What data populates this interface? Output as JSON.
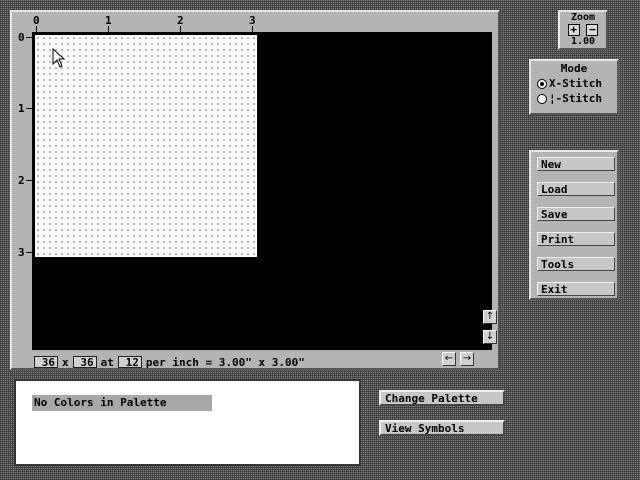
{
  "canvas": {
    "ruler_top": [
      "0",
      "1",
      "2",
      "3"
    ],
    "ruler_left": [
      "0",
      "1",
      "2",
      "3"
    ],
    "width_value": "36",
    "height_value": "36",
    "x_text": "x",
    "at_text": "at",
    "count_value": "12",
    "summary_text": "per inch = 3.00\" x 3.00\"",
    "scroll_icons": [
      "arrow-up-icon",
      "arrow-down-icon",
      "arrow-left-icon",
      "arrow-right-icon"
    ]
  },
  "zoom": {
    "title": "Zoom",
    "plus_label": "+",
    "minus_label": "−",
    "value": "1.00"
  },
  "mode": {
    "title": "Mode",
    "options": [
      {
        "label": "X-Stitch",
        "selected": true
      },
      {
        "label": "¦-Stitch",
        "selected": false
      }
    ]
  },
  "menu": {
    "items": [
      "New",
      "Load",
      "Save",
      "Print",
      "Tools",
      "Exit"
    ]
  },
  "palette": {
    "empty_label": "No Colors in Palette",
    "change_button": "Change Palette",
    "view_button": "View Symbols"
  },
  "colors": {
    "panel": "#b4b4b4",
    "canvas": "#000000",
    "grid": "#ffffff"
  }
}
